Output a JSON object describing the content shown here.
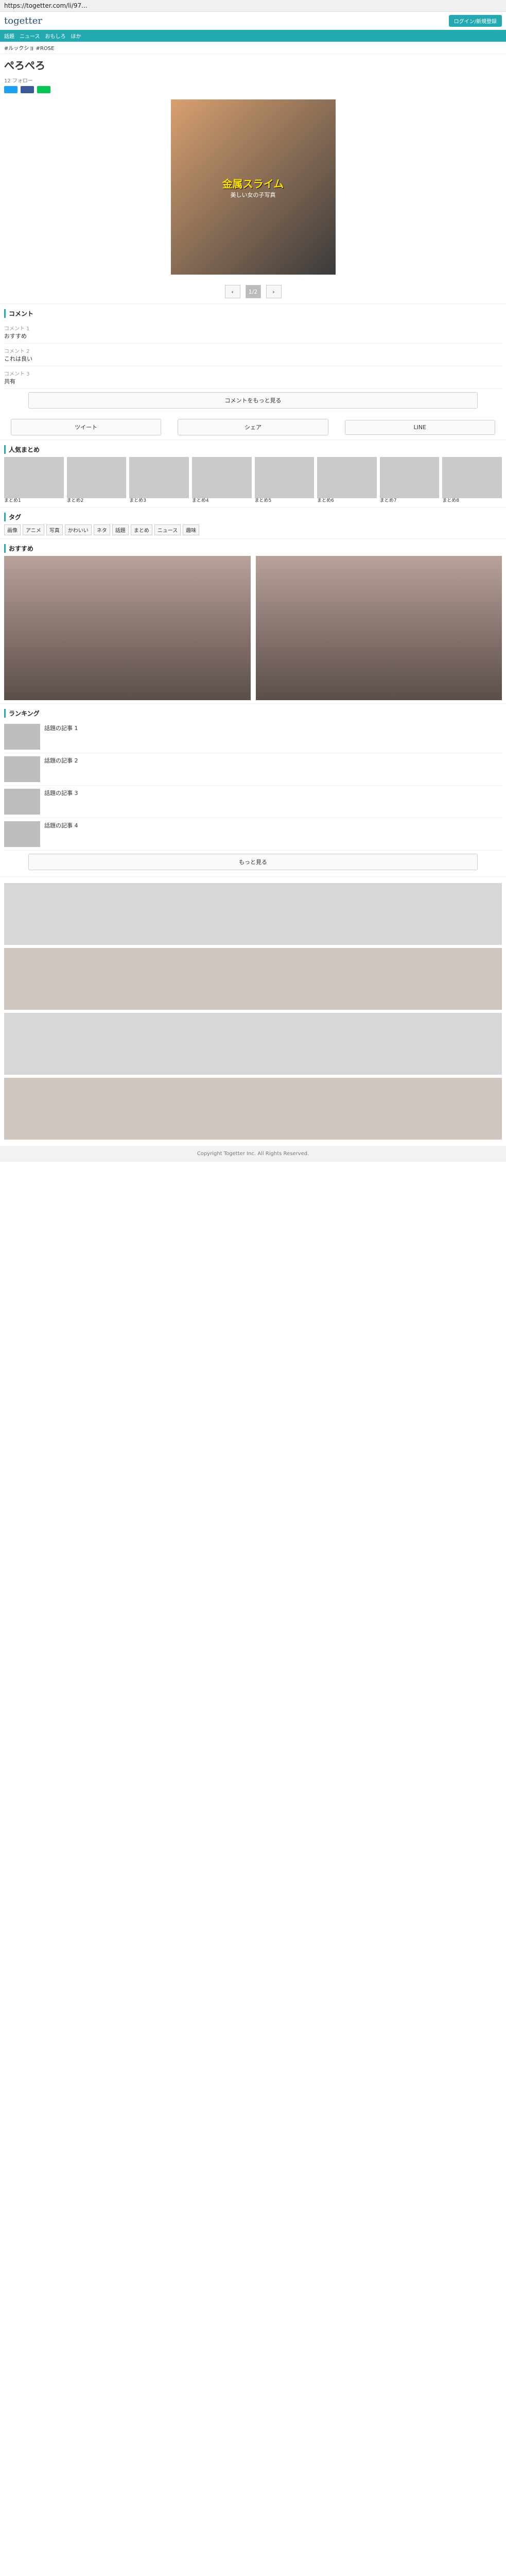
{
  "browser": {
    "url": "https://togetter.com/li/97..."
  },
  "brand": {
    "logo": "togetter",
    "button": "ログイン/新規登録"
  },
  "nav": {
    "items": [
      "話題",
      "ニュース",
      "おもしろ",
      "ほか"
    ]
  },
  "crumb": {
    "text": "#ルックショ #ROSE"
  },
  "article": {
    "title": "ぺろぺろ",
    "meta": "12 フォロー",
    "hero_text": "金属スライム",
    "hero_sub": "美しい女の子写真"
  },
  "pager": {
    "prev": "‹",
    "page": "1/2",
    "next": "›"
  },
  "comments": {
    "header": "コメント",
    "items": [
      {
        "meta": "コメント 1",
        "body": "おすすめ"
      },
      {
        "meta": "コメント 2",
        "body": "これは良い"
      },
      {
        "meta": "コメント 3",
        "body": "共有"
      }
    ],
    "more": "コメントをもっと見る"
  },
  "share": {
    "twitter": "ツイート",
    "facebook": "シェア",
    "line": "LINE"
  },
  "sections": {
    "popular": "人気まとめ",
    "tags": "タグ",
    "recommend": "おすすめ",
    "ranking": "ランキング",
    "more_button": "もっと見る"
  },
  "tag_list": [
    "画像",
    "アニメ",
    "写真",
    "かわいい",
    "ネタ",
    "話題",
    "まとめ",
    "ニュース",
    "趣味"
  ],
  "grid_captions": [
    "まとめ1",
    "まとめ2",
    "まとめ3",
    "まとめ4",
    "まとめ5",
    "まとめ6",
    "まとめ7",
    "まとめ8"
  ],
  "list_items": [
    {
      "title": "話題の記事 1"
    },
    {
      "title": "話題の記事 2"
    },
    {
      "title": "話題の記事 3"
    },
    {
      "title": "話題の記事 4"
    }
  ],
  "footer": {
    "text": "Copyright Togetter Inc. All Rights Reserved."
  }
}
